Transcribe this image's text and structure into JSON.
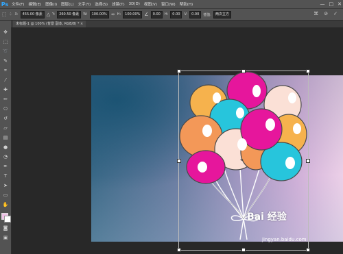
{
  "app": {
    "logo": "Ps",
    "menu": [
      "文件(F)",
      "编辑(E)",
      "图像(I)",
      "图层(L)",
      "文字(Y)",
      "选择(S)",
      "滤镜(T)",
      "3D(D)",
      "视图(V)",
      "窗口(W)",
      "帮助(H)"
    ],
    "window_controls": [
      "—",
      "□",
      "✕"
    ]
  },
  "options": {
    "x_label": "X:",
    "x_value": "455.00 像素",
    "y_label": "Y:",
    "y_value": "260.50 像素",
    "w_label": "W:",
    "w_value": "100.00%",
    "h_label": "H:",
    "h_value": "100.00%",
    "angle_value": "0.00",
    "h_skew_label": "H:",
    "h_skew_value": "0.00",
    "v_skew_label": "V:",
    "v_skew_value": "0.00",
    "interp_label": "插值:",
    "interp_value": "两次立方"
  },
  "document": {
    "tab_label": "未标题-1 @ 100% (背景 副本, RGB/8) * ×"
  },
  "watermark": {
    "brand": "Bai 经验",
    "url": "jingyan.baidu.com"
  },
  "colors": {
    "foreground": "#f0c3e8",
    "background": "#ffffff"
  }
}
